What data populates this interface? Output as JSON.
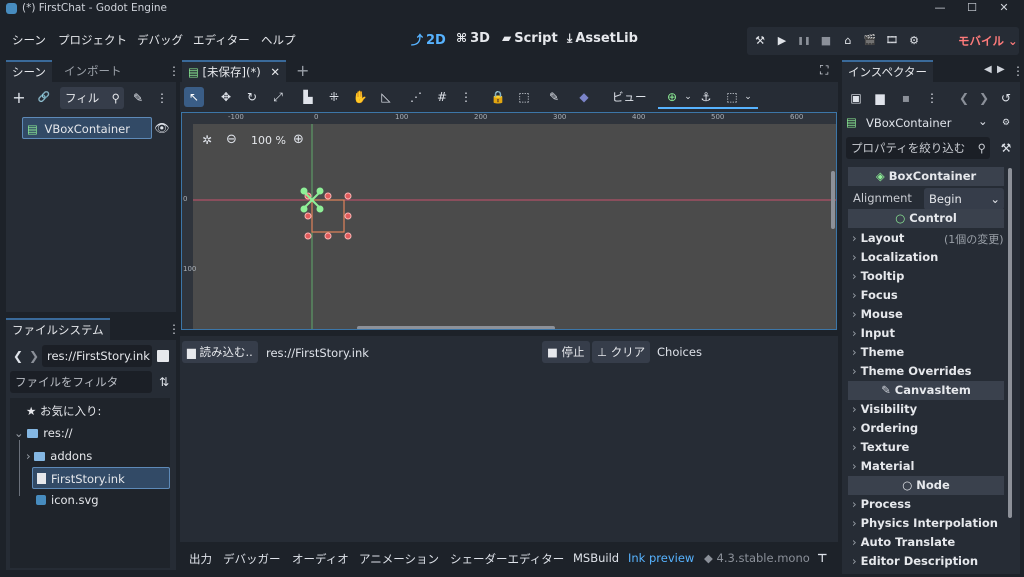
{
  "window": {
    "title": "(*) FirstChat - Godot Engine",
    "controls": [
      "—",
      "☐",
      "✕"
    ]
  },
  "menu": [
    "シーン",
    "プロジェクト",
    "デバッグ",
    "エディター",
    "ヘルプ"
  ],
  "workspaces": [
    {
      "icon": "⤴",
      "label": "2D"
    },
    {
      "icon": "⌘",
      "label": "3D"
    },
    {
      "icon": "▰",
      "label": "Script"
    },
    {
      "icon": "⤓",
      "label": "AssetLib"
    }
  ],
  "run_bar": {
    "renderer": "モバイル",
    "chevron": "⌄",
    "icons": [
      "⚒",
      "▶",
      "❚❚",
      "■",
      "⌂",
      "🎬",
      "🎞",
      "⚙"
    ]
  },
  "scene_dock": {
    "tabs": [
      "シーン",
      "インポート"
    ],
    "add": "+",
    "link": "🔗",
    "filter_text": "フィル",
    "kebab": "⋮",
    "root_node": "VBoxContainer",
    "visibility_icon": "👁"
  },
  "filesystem_dock": {
    "tab": "ファイルシステム",
    "path": "res://FirstStory.ink",
    "filter_placeholder": "ファイルをフィルタ",
    "favorites": "お気に入り:",
    "root": "res://",
    "items": [
      {
        "name": "addons",
        "type": "folder",
        "expanded": false
      },
      {
        "name": "FirstStory.ink",
        "type": "file",
        "selected": true
      },
      {
        "name": "icon.svg",
        "type": "image"
      }
    ]
  },
  "editor_tabs": {
    "scene_tab": "[未保存](*)",
    "close": "✕",
    "add": "+",
    "fullscreen": "⛶"
  },
  "toolbar_2d": {
    "view_label": "ビュー"
  },
  "viewport": {
    "zoom": "100 %",
    "ruler_top": [
      "-100",
      "0",
      "100",
      "200",
      "300",
      "400",
      "500",
      "600"
    ],
    "ruler_left": [
      "0",
      "100"
    ]
  },
  "ink_panel": {
    "load_button": "読み込む..",
    "file": "res://FirstStory.ink",
    "stop_button": "停止",
    "clear_button": "クリア",
    "choices_label": "Choices"
  },
  "bottom_tabs": [
    "出力",
    "デバッガー",
    "オーディオ",
    "アニメーション",
    "シェーダーエディター",
    "MSBuild",
    "Ink preview"
  ],
  "version": "4.3.stable.mono",
  "inspector": {
    "tab": "インスペクター",
    "node": "VBoxContainer",
    "filter_placeholder": "プロパティを絞り込む",
    "sections": {
      "box_container": "BoxContainer",
      "alignment_label": "Alignment",
      "alignment_value": "Begin",
      "control": "Control",
      "canvas_item": "CanvasItem",
      "node": "Node"
    },
    "control_props": [
      "Layout",
      "Localization",
      "Tooltip",
      "Focus",
      "Mouse",
      "Input",
      "Theme",
      "Theme Overrides"
    ],
    "layout_note": "(1個の変更)",
    "canvas_props": [
      "Visibility",
      "Ordering",
      "Texture",
      "Material"
    ],
    "node_props": [
      "Process",
      "Physics Interpolation",
      "Auto Translate",
      "Editor Description"
    ]
  },
  "colors": {
    "accent": "#57b3ff",
    "renderer_mobile": "#ff7b7b",
    "node_green": "#8eef97",
    "viewport_bg": "#4b4b4b"
  }
}
